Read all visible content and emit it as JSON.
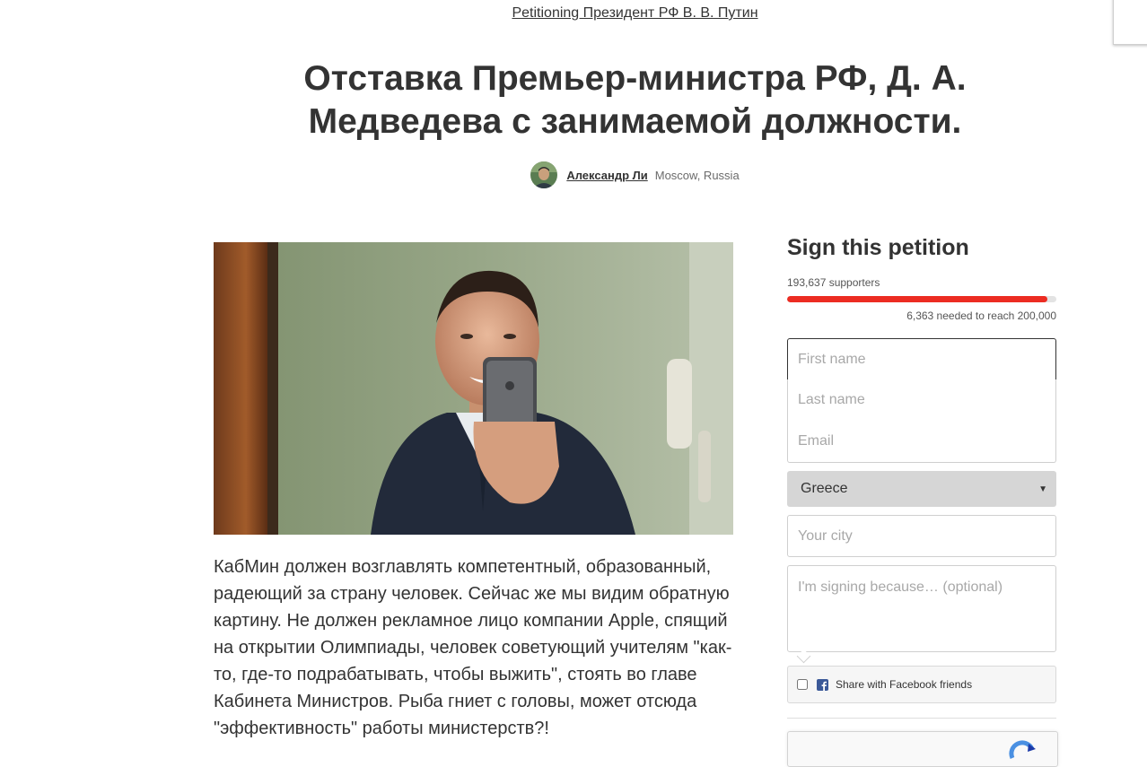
{
  "header": {
    "petitioning": "Petitioning Президент РФ В. В. Путин",
    "title": "Отставка Премьер-министра РФ, Д. А. Медведева с занимаемой должности."
  },
  "author": {
    "name": "Александр Ли",
    "location": "Moscow, Russia"
  },
  "petition": {
    "description": "КабМин должен возглавлять компетентный, образованный, радеющий за страну человек. Сейчас же мы видим обратную картину. Не должен рекламное лицо компании Apple, спящий на открытии Олимпиады, человек советующий учителям \"как-то, где-то подрабатывать, чтобы выжить\", стоять во главе Кабинета Министров. Рыба гниет с головы, может отсюда \"эффективность\" работы министерств?!"
  },
  "sign_form": {
    "heading": "Sign this petition",
    "supporters_text": "193,637 supporters",
    "supporters_count": 193637,
    "goal": 200000,
    "progress_fraction": 0.968,
    "needed_text": "6,363 needed to reach 200,000",
    "first_name_placeholder": "First name",
    "last_name_placeholder": "Last name",
    "email_placeholder": "Email",
    "country_selected": "Greece",
    "city_placeholder": "Your city",
    "reason_placeholder": "I'm signing because… (optional)",
    "share_facebook_label": "Share with Facebook friends"
  },
  "icons": {
    "facebook": "facebook-icon",
    "dropdown": "caret-down-icon",
    "captcha": "recaptcha-icon"
  },
  "colors": {
    "progress_fill": "#ec2c22",
    "progress_track": "#e3e3e3",
    "facebook_blue": "#3b5998",
    "text": "#333333"
  }
}
